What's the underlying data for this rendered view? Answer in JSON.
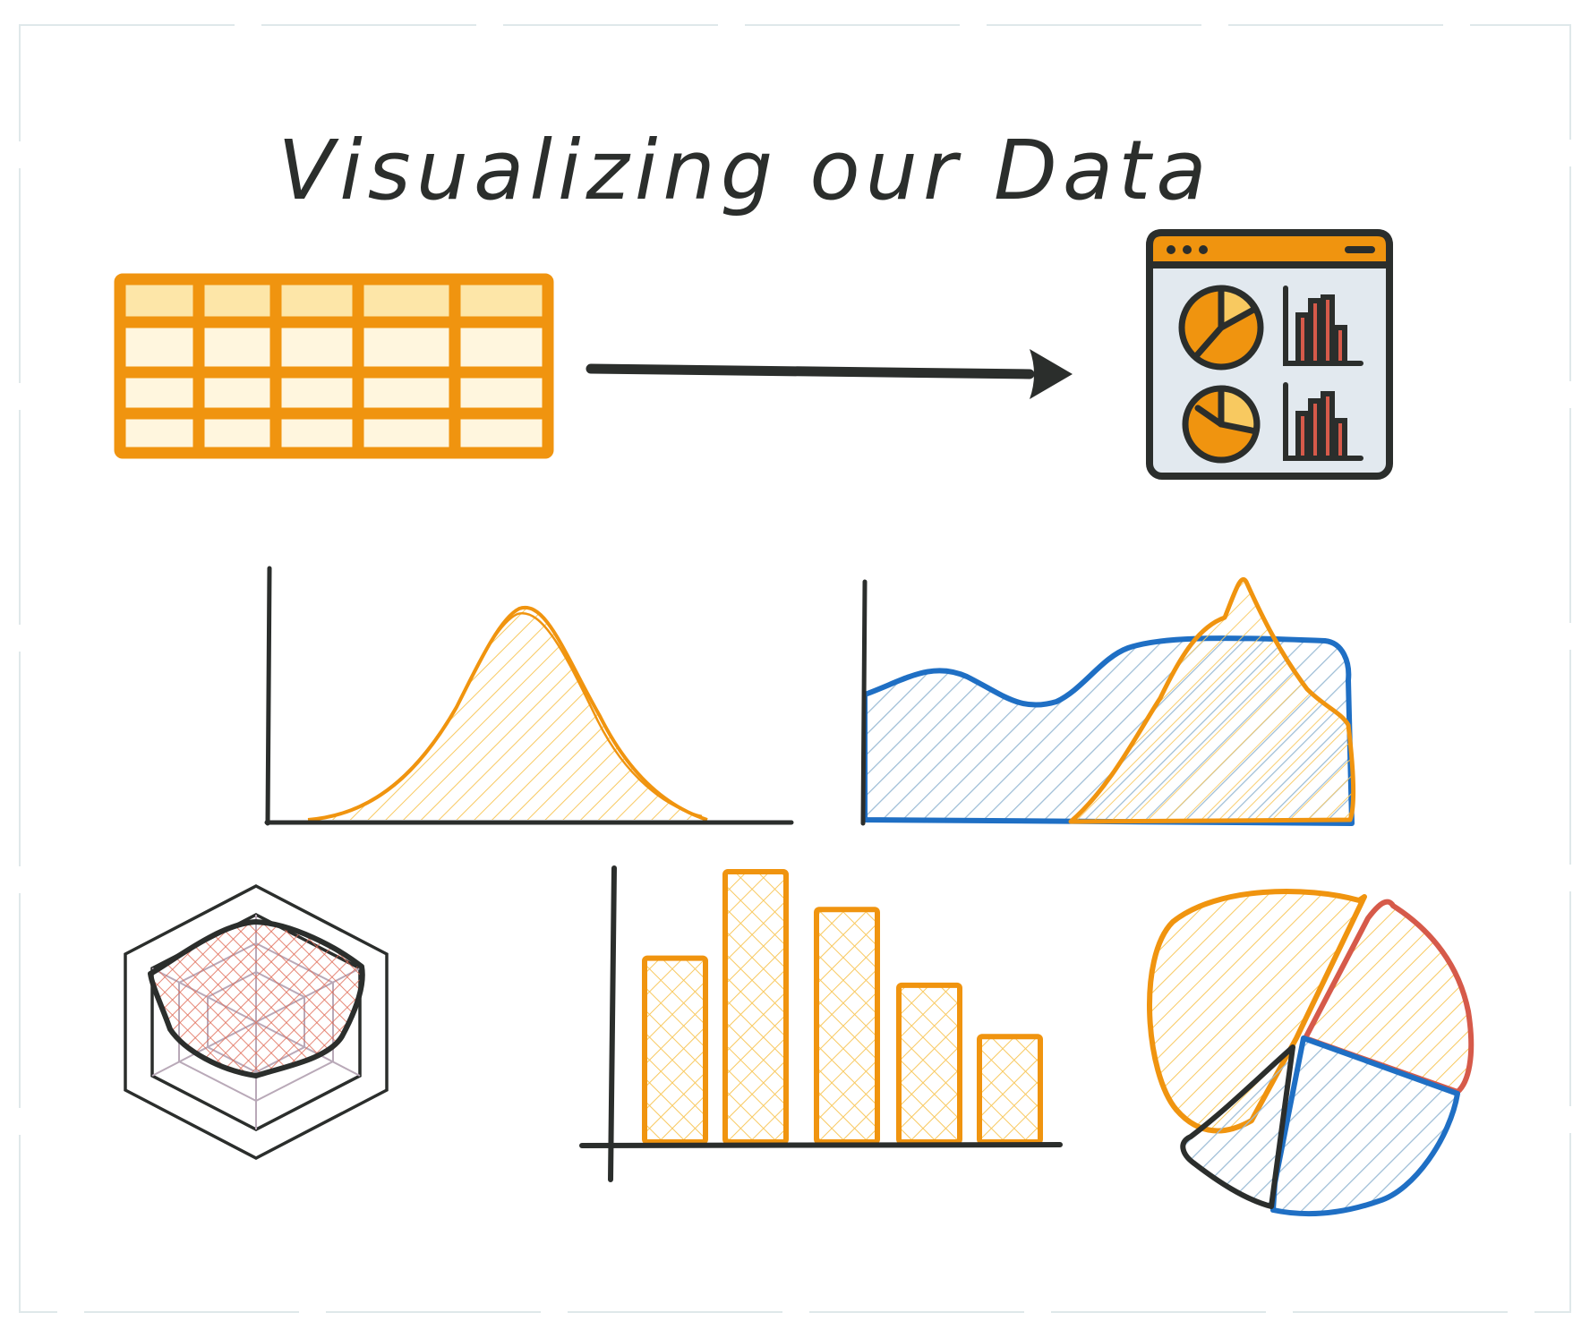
{
  "title": "Visualizing our Data",
  "colors": {
    "orange": "#f0940f",
    "orange_light": "#fde6a8",
    "orange_pale": "#fff6de",
    "blue": "#1f6fc4",
    "blue_light": "#c7d9e6",
    "red": "#d65a4a",
    "ink": "#2b2e2c",
    "panel_bg": "#e2e9ef"
  },
  "icons": {
    "table": "spreadsheet-table-icon",
    "arrow": "arrow-right-icon",
    "dashboard": "dashboard-window-icon"
  },
  "charts": {
    "bell": "density-curve",
    "area": "overlapping-area",
    "radar": "radar",
    "bar": "bar",
    "pie": "pie"
  },
  "bar_values": [
    0.68,
    1.0,
    0.86,
    0.58,
    0.39
  ]
}
